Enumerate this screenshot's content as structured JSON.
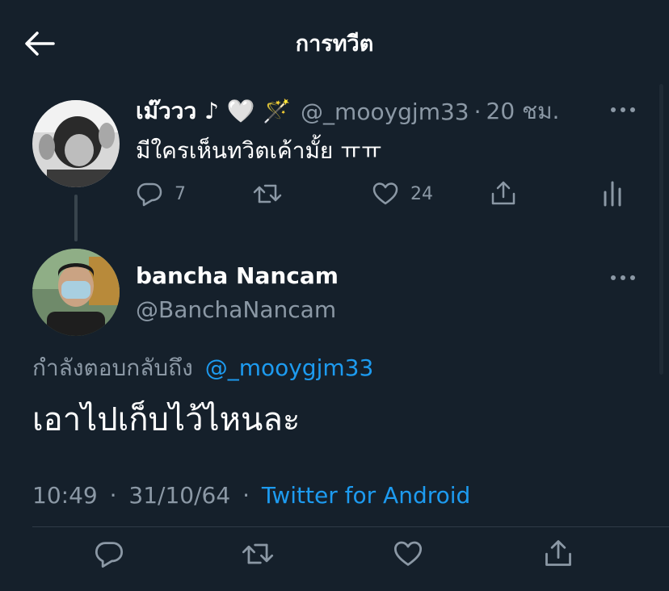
{
  "header": {
    "title": "การทวีต"
  },
  "parent_tweet": {
    "display_name": "เม๊ววว ♪ 🤍 🪄",
    "handle": "@_mooygjm33",
    "separator": "·",
    "time": "20 ชม.",
    "text": "มีใครเห็นทวิตเค้ามั้ย ㅠㅠ",
    "reply_count": "7",
    "like_count": "24"
  },
  "main_tweet": {
    "display_name": "bancha Nancam",
    "handle": "@BanchaNancam",
    "replying_to_label": "กำลังตอบกลับถึง",
    "replying_to_handle": "@_mooygjm33",
    "text": "เอาไปเก็บไว้ไหนละ",
    "time": "10:49",
    "date": "31/10/64",
    "separator": "·",
    "source": "Twitter for Android"
  },
  "colors": {
    "background": "#15202b",
    "muted": "#8b98a5",
    "accent": "#1d9bf0",
    "divider": "#2f3b47"
  },
  "icons": [
    "back-arrow-icon",
    "more-icon",
    "reply-icon",
    "retweet-icon",
    "like-icon",
    "share-icon",
    "analytics-icon",
    "avatar"
  ]
}
